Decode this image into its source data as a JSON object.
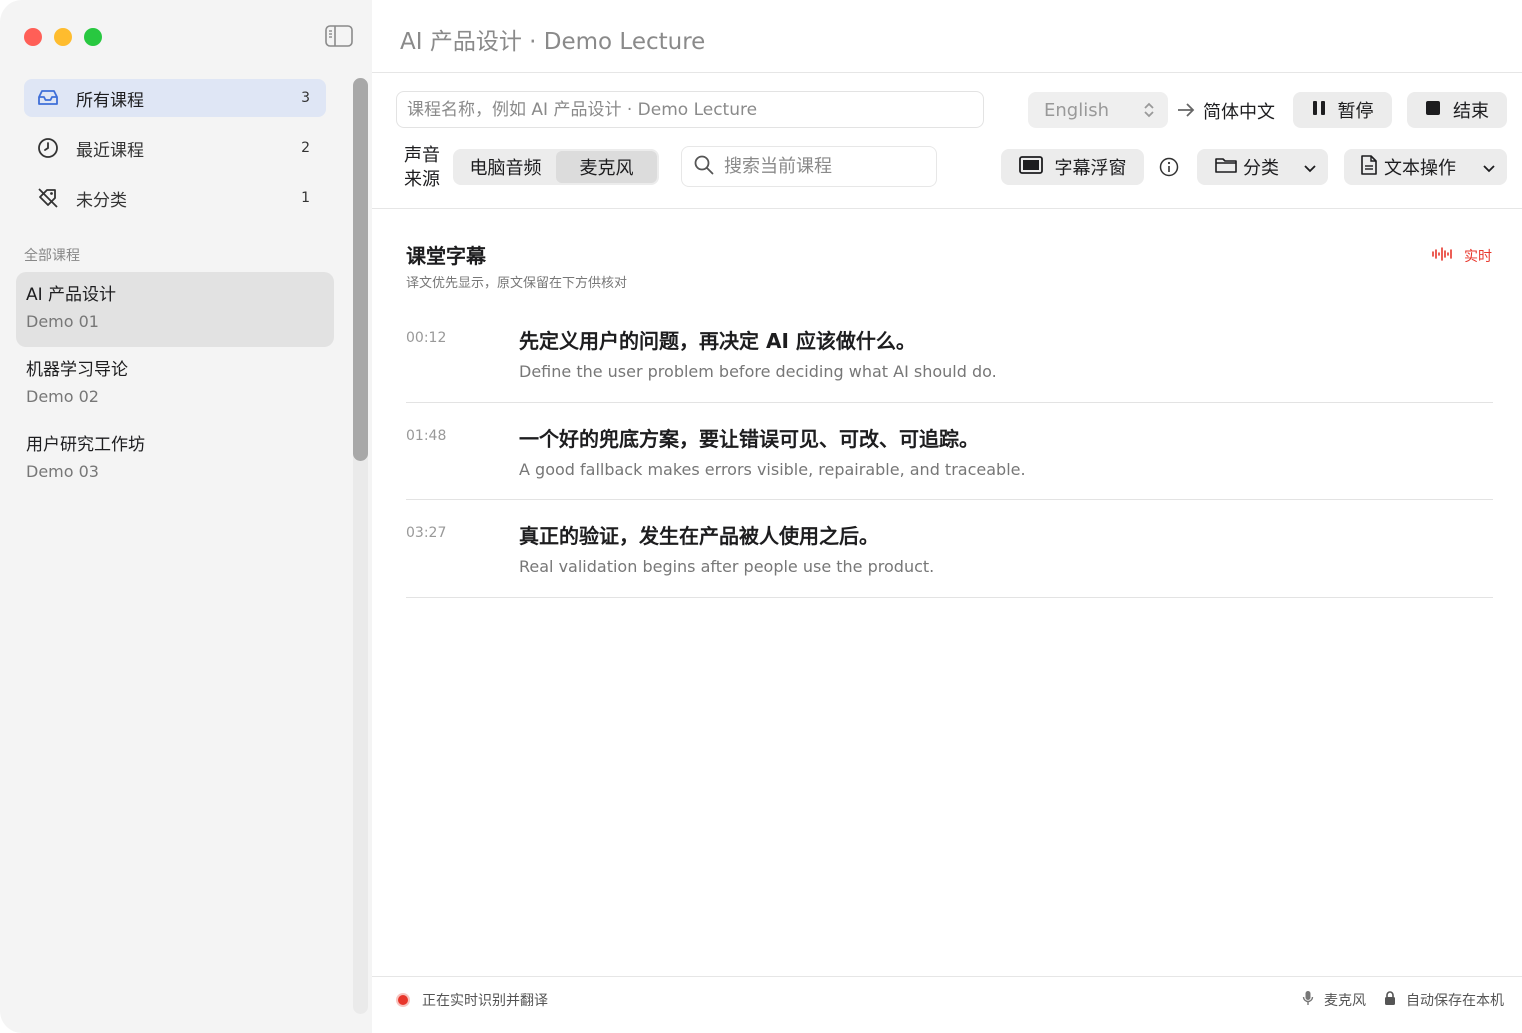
{
  "window": {
    "title": "AI 产品设计 · Demo Lecture"
  },
  "sidebar": {
    "nav": [
      {
        "label": "所有课程",
        "count": "3",
        "icon": "tray-icon"
      },
      {
        "label": "最近课程",
        "count": "2",
        "icon": "clock-icon"
      },
      {
        "label": "未分类",
        "count": "1",
        "icon": "tag-slash-icon"
      }
    ],
    "section_title": "全部课程",
    "courses": [
      {
        "name": "AI 产品设计",
        "sub": "Demo 01"
      },
      {
        "name": "机器学习导论",
        "sub": "Demo 02"
      },
      {
        "name": "用户研究工作坊",
        "sub": "Demo 03"
      }
    ]
  },
  "toolbar": {
    "course_placeholder": "课程名称，例如 AI 产品设计 · Demo Lecture",
    "source_lang": "English",
    "target_lang": "简体中文",
    "pause_label": "暂停",
    "stop_label": "结束",
    "source_label": "声音来源",
    "source_options": [
      "电脑音频",
      "麦克风"
    ],
    "selected_source": "麦克风",
    "search_placeholder": "搜索当前课程",
    "float_label": "字幕浮窗",
    "category_label": "分类",
    "text_ops_label": "文本操作"
  },
  "captions": {
    "title": "课堂字幕",
    "subtitle": "译文优先显示，原文保留在下方供核对",
    "live_label": "实时",
    "items": [
      {
        "time": "00:12",
        "zh": "先定义用户的问题，再决定 AI 应该做什么。",
        "en": "Define the user problem before deciding what AI should do."
      },
      {
        "time": "01:48",
        "zh": "一个好的兜底方案，要让错误可见、可改、可追踪。",
        "en": "A good fallback makes errors visible, repairable, and traceable."
      },
      {
        "time": "03:27",
        "zh": "真正的验证，发生在产品被人使用之后。",
        "en": "Real validation begins after people use the product."
      }
    ]
  },
  "status": {
    "left": "正在实时识别并翻译",
    "mic": "麦克风",
    "save": "自动保存在本机"
  },
  "colors": {
    "accent": "#3f6fd8",
    "live_red": "#e8362b",
    "active_nav_bg": "#dfe6f5"
  }
}
